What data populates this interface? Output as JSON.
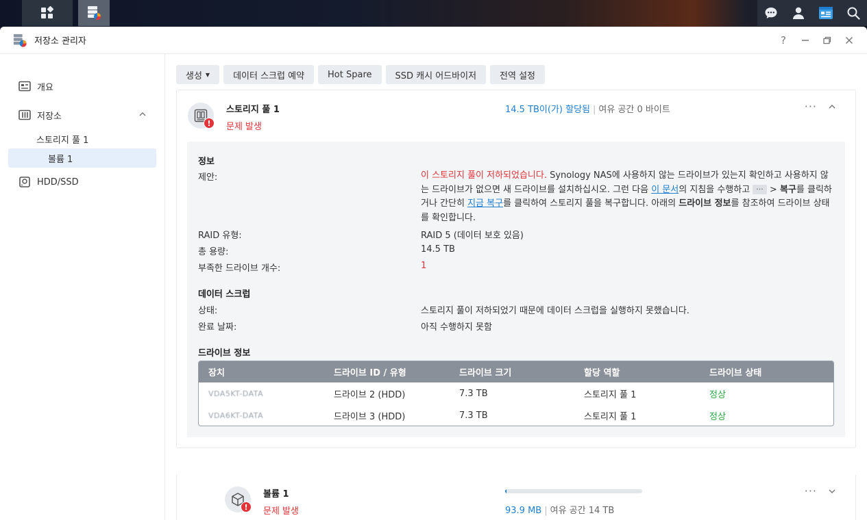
{
  "window": {
    "title": "저장소 관리자",
    "help": "?"
  },
  "sidebar": {
    "overview": "개요",
    "storage": "저장소",
    "pool": "스토리지 풀 1",
    "volume": "볼륨 1",
    "hdd": "HDD/SSD"
  },
  "toolbar": {
    "create": "생성",
    "scrub_schedule": "데이터 스크럽 예약",
    "hot_spare": "Hot Spare",
    "ssd_advisor": "SSD 캐시 어드바이저",
    "global_settings": "전역 설정"
  },
  "pool": {
    "name": "스토리지 풀 1",
    "status": "문제 발생",
    "allocated": "14.5 TB이(가) 할당됨",
    "free": "여유 공간 0 바이트"
  },
  "info": {
    "section_title": "정보",
    "suggest_label": "제안:",
    "suggest_red": "이 스토리지 풀이 저하되었습니다.",
    "suggest_1": " Synology NAS에 사용하지 않는 드라이브가 있는지 확인하고 사용하지 않는 드라이브가 없으면 새 드라이브를 설치하십시오. 그런 다음 ",
    "suggest_link1": "이 문서",
    "suggest_2": "의 지침을 수행하고 ",
    "suggest_dots": "···",
    "suggest_3": " > ",
    "suggest_bold1": "복구",
    "suggest_4": "를 클릭하거나 간단히 ",
    "suggest_link2": "지금 복구",
    "suggest_5": "를 클릭하여 스토리지 풀을 복구합니다. 아래의 ",
    "suggest_bold2": "드라이브 정보",
    "suggest_6": "를 참조하여 드라이브 상태를 확인합니다.",
    "raid_label": "RAID 유형:",
    "raid_value": "RAID 5 (데이터 보호 있음)",
    "capacity_label": "총 용량:",
    "capacity_value": "14.5 TB",
    "missing_label": "부족한 드라이브 개수:",
    "missing_value": "1"
  },
  "scrub": {
    "section_title": "데이터 스크럽",
    "status_label": "상태:",
    "status_value": "스토리지 풀이 저하되었기 때문에 데이터 스크럽을 실행하지 못했습니다.",
    "date_label": "완료 날짜:",
    "date_value": "아직 수행하지 못함"
  },
  "drives": {
    "section_title": "드라이브 정보",
    "headers": [
      "장치",
      "드라이브 ID / 유형",
      "드라이브 크기",
      "할당 역할",
      "드라이브 상태"
    ],
    "rows": [
      [
        "VDA5KT-DATA",
        "드라이브 2 (HDD)",
        "7.3 TB",
        "스토리지 풀 1",
        "정상"
      ],
      [
        "VDA6KT-DATA",
        "드라이브 3 (HDD)",
        "7.3 TB",
        "스토리지 풀 1",
        "정상"
      ]
    ]
  },
  "volume": {
    "name": "볼륨 1",
    "status": "문제 발생",
    "used": "93.9 MB",
    "free": "여유 공간 14 TB",
    "usage_fraction": 0.01
  },
  "colors": {
    "accent": "#1e7fd0",
    "error": "#e0353a",
    "ok": "#28a745"
  }
}
